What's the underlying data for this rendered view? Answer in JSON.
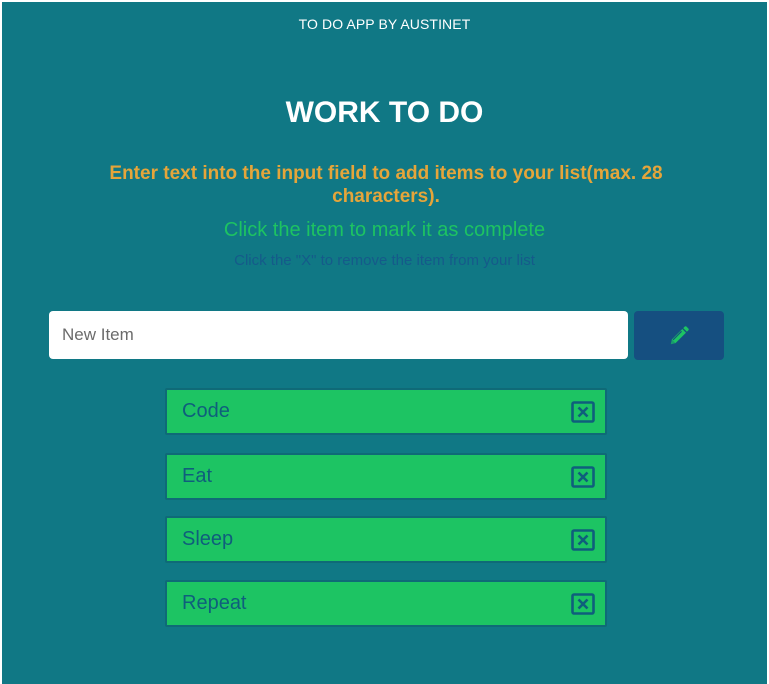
{
  "header": {
    "app_title": "TO DO APP BY AUSTINET"
  },
  "main": {
    "title": "WORK TO DO",
    "instruction_add": "Enter text into the input field to add items to your list(max. 28 characters).",
    "instruction_complete": "Click the item to mark it as complete",
    "instruction_remove": "Click the \"X\" to remove the item from your list"
  },
  "input": {
    "placeholder": "New Item",
    "value": ""
  },
  "add_button": {
    "icon": "pencil-icon"
  },
  "todos": [
    {
      "label": "Code",
      "remove_icon": "close-box-icon"
    },
    {
      "label": "Eat",
      "remove_icon": "close-box-icon"
    },
    {
      "label": "Sleep",
      "remove_icon": "close-box-icon"
    },
    {
      "label": "Repeat",
      "remove_icon": "close-box-icon"
    }
  ],
  "colors": {
    "background": "#107885",
    "title": "#ffffff",
    "instruction_add": "#e5a53a",
    "instruction_complete": "#1dc362",
    "instruction_remove": "#155a8a",
    "add_button": "#154f80",
    "pencil": "#1dc463",
    "item_background": "#1dc463",
    "item_text": "#0f5e7c"
  }
}
